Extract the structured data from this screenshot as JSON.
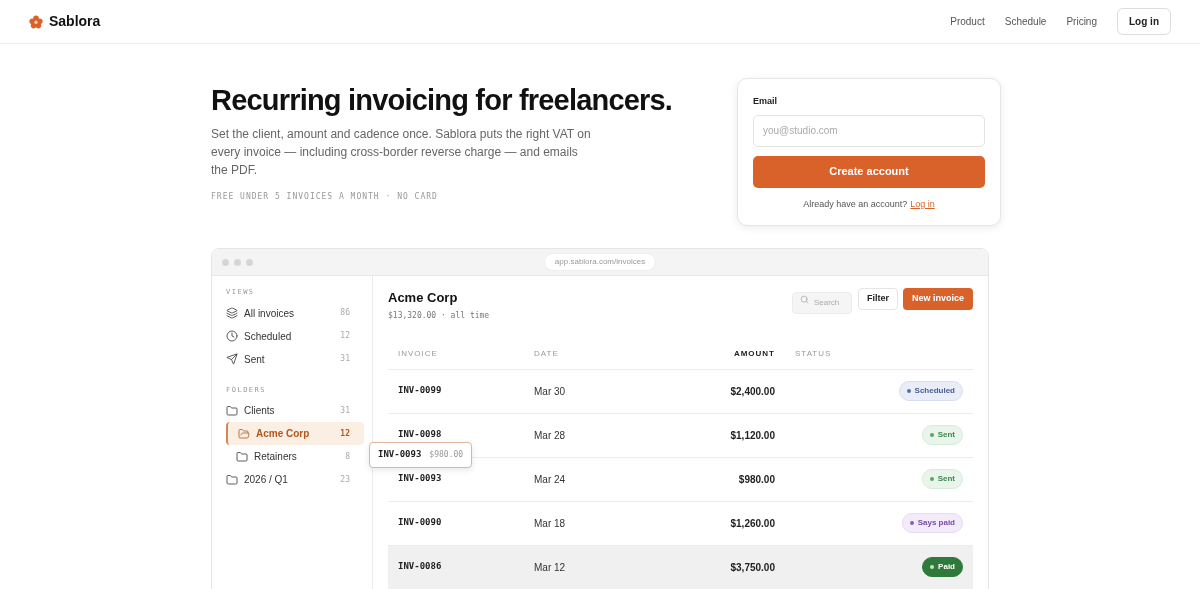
{
  "brand": {
    "name": "Sablora"
  },
  "nav": {
    "links": [
      "Product",
      "Schedule",
      "Pricing"
    ],
    "login": "Log in"
  },
  "hero": {
    "title": "Recurring invoicing for freelancers.",
    "body": "Set the client, amount and cadence once. Sablora puts the right VAT on every invoice — including cross-border reverse charge — and emails the PDF.",
    "note": "FREE UNDER 5 INVOICES A MONTH · NO CARD"
  },
  "signup": {
    "label": "Email",
    "placeholder": "you@studio.com",
    "button": "Create account",
    "prompt": "Already have an account?",
    "link": "Log in"
  },
  "app": {
    "url": "app.sablora.com/invoices",
    "sidebar": {
      "views_heading": "VIEWS",
      "views": [
        {
          "label": "All invoices",
          "count": "86",
          "selected": false
        },
        {
          "label": "Scheduled",
          "count": "12",
          "selected": false
        },
        {
          "label": "Sent",
          "count": "31",
          "selected": false
        }
      ],
      "folders_heading": "FOLDERS",
      "folders": [
        {
          "label": "Clients",
          "count": "31",
          "selected": false,
          "children": [
            {
              "label": "Acme Corp",
              "count": "12",
              "selected": true
            },
            {
              "label": "Retainers",
              "count": "8",
              "selected": false
            }
          ]
        },
        {
          "label": "2026 / Q1",
          "count": "23",
          "selected": false
        }
      ]
    },
    "header": {
      "title": "Acme Corp",
      "subtitle": "$13,320.00 · all time",
      "search_placeholder": "Search",
      "filter": "Filter",
      "new": "New invoice"
    },
    "columns": [
      {
        "label": "INVOICE",
        "sorted": false
      },
      {
        "label": "DATE",
        "sorted": false
      },
      {
        "label": "AMOUNT",
        "sorted": true
      },
      {
        "label": "STATUS",
        "sorted": false
      }
    ],
    "rows": [
      {
        "invoice": "INV-0099",
        "date": "Mar 30",
        "amount": "$2,400.00",
        "status": {
          "label": "Scheduled",
          "kind": "scheduled"
        },
        "selected": false
      },
      {
        "invoice": "INV-0098",
        "date": "Mar 28",
        "amount": "$1,120.00",
        "status": {
          "label": "Sent",
          "kind": "sent"
        },
        "selected": false
      },
      {
        "invoice": "INV-0093",
        "date": "Mar 24",
        "amount": "$980.00",
        "status": {
          "label": "Sent",
          "kind": "sent"
        },
        "selected": false
      },
      {
        "invoice": "INV-0090",
        "date": "Mar 18",
        "amount": "$1,260.00",
        "status": {
          "label": "Says paid",
          "kind": "says_paid"
        },
        "selected": false
      },
      {
        "invoice": "INV-0086",
        "date": "Mar 12",
        "amount": "$3,750.00",
        "status": {
          "label": "Paid",
          "kind": "paid"
        },
        "selected": true
      }
    ],
    "drag_ghost": {
      "invoice": "INV-0093",
      "amount": "$980.00"
    }
  }
}
